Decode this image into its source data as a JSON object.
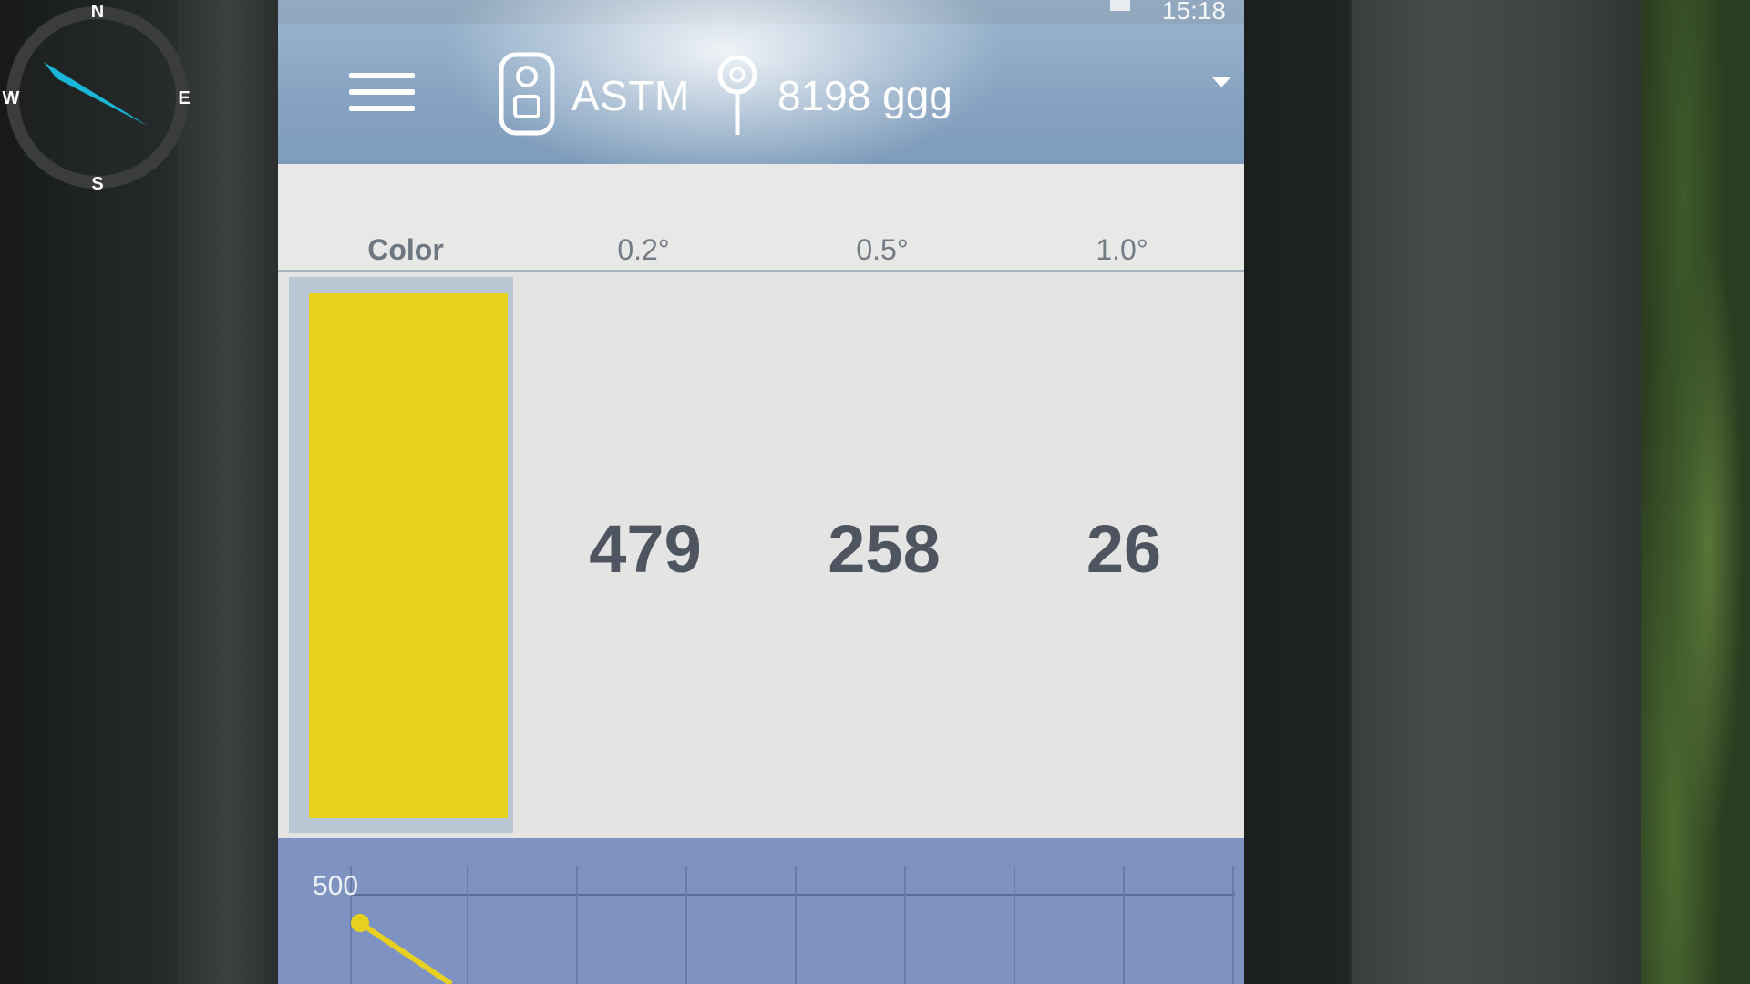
{
  "compass": {
    "north": "N",
    "south": "S",
    "east": "E",
    "west": "W",
    "needle_color": "#19b6d8"
  },
  "status_bar": {
    "time": "15:18"
  },
  "app_bar": {
    "device_icon": "device-icon",
    "standard": "ASTM",
    "location_icon": "pin-icon",
    "sample_name": "8198 ggg"
  },
  "table": {
    "headers": [
      "Color",
      "0.2°",
      "0.5°",
      "1.0°"
    ],
    "swatch_color": "#e6d21a",
    "values": [
      "479",
      "258",
      "26"
    ]
  },
  "graph": {
    "y_tick_label": "500",
    "line_color": "#e8d020"
  }
}
